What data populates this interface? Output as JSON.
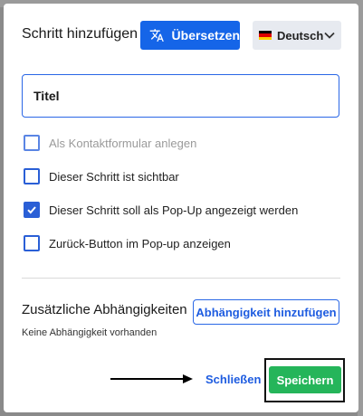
{
  "dialog": {
    "title": "Schritt hinzufügen",
    "translate_button": "Übersetzen",
    "language": {
      "label": "Deutsch",
      "flag": "german-flag-icon"
    },
    "title_field": {
      "value": "Titel"
    },
    "checkboxes": [
      {
        "label": "Als Kontaktformular anlegen",
        "checked": false,
        "disabled": true
      },
      {
        "label": "Dieser Schritt ist sichtbar",
        "checked": false,
        "disabled": false
      },
      {
        "label": "Dieser Schritt soll als Pop-Up angezeigt werden",
        "checked": true,
        "disabled": false
      },
      {
        "label": "Zurück-Button im Pop-up anzeigen",
        "checked": false,
        "disabled": false
      }
    ],
    "dependencies": {
      "heading": "Zusätzliche Abhängigkeiten",
      "add_button": "Abhängigkeit hinzufügen",
      "empty_text": "Keine Abhängigkeit vorhanden"
    },
    "footer": {
      "close_button": "Schließen",
      "save_button": "Speichern"
    }
  },
  "colors": {
    "primary": "#1565e8",
    "save": "#25b55a",
    "checkbox": "#2a5fd6"
  }
}
